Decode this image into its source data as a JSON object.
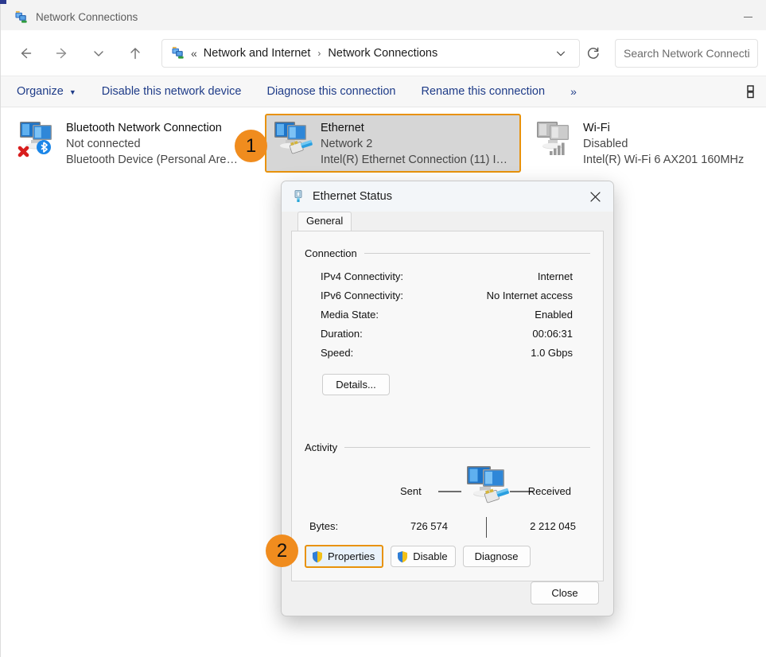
{
  "window": {
    "title": "Network Connections",
    "app_icon": "network-connections-icon",
    "minimize_label": "Minimize"
  },
  "nav": {
    "back": "back-arrow-icon",
    "forward": "forward-arrow-icon",
    "recent": "chevron-down-icon",
    "up": "up-arrow-icon"
  },
  "address": {
    "icon": "network-connections-icon",
    "overflow": "«",
    "crumbs": [
      "Network and Internet",
      "Network Connections"
    ],
    "separator": "›",
    "dropdown": "chevron-down-icon",
    "refresh": "refresh-icon"
  },
  "search": {
    "placeholder": "Search Network Connecti",
    "value": ""
  },
  "commandbar": {
    "items": [
      {
        "label": "Organize",
        "has_caret": true
      },
      {
        "label": "Disable this network device",
        "has_caret": false
      },
      {
        "label": "Diagnose this connection",
        "has_caret": false
      },
      {
        "label": "Rename this connection",
        "has_caret": false
      }
    ],
    "more": "»",
    "view_icon": "view-options-icon"
  },
  "connections": [
    {
      "name": "Bluetooth Network Connection",
      "status": "Not connected",
      "device": "Bluetooth Device (Personal Area …",
      "icon": "bluetooth-network-adapter-icon",
      "selected": false
    },
    {
      "name": "Ethernet",
      "status": "Network 2",
      "device": "Intel(R) Ethernet Connection (11) I…",
      "icon": "ethernet-adapter-icon",
      "selected": true
    },
    {
      "name": "Wi-Fi",
      "status": "Disabled",
      "device": "Intel(R) Wi-Fi 6 AX201 160MHz",
      "icon": "wifi-adapter-disabled-icon",
      "selected": false
    }
  ],
  "badges": [
    {
      "number": "1"
    },
    {
      "number": "2"
    }
  ],
  "dialog": {
    "title": "Ethernet Status",
    "icon": "network-cable-icon",
    "close": "close-icon",
    "tabs": [
      {
        "label": "General",
        "active": true
      }
    ],
    "connection": {
      "group_label": "Connection",
      "rows": [
        {
          "key": "IPv4 Connectivity:",
          "value": "Internet"
        },
        {
          "key": "IPv6 Connectivity:",
          "value": "No Internet access"
        },
        {
          "key": "Media State:",
          "value": "Enabled"
        },
        {
          "key": "Duration:",
          "value": "00:06:31"
        },
        {
          "key": "Speed:",
          "value": "1.0 Gbps"
        }
      ],
      "details_button": "Details..."
    },
    "activity": {
      "group_label": "Activity",
      "sent_label": "Sent",
      "received_label": "Received",
      "icon": "activity-transfer-icon",
      "bytes_label": "Bytes:",
      "bytes_sent": "726 574",
      "bytes_received": "2 212 045"
    },
    "actions": [
      {
        "label": "Properties",
        "shield": true,
        "focused": true
      },
      {
        "label": "Disable",
        "shield": true,
        "focused": false
      },
      {
        "label": "Diagnose",
        "shield": false,
        "focused": false
      }
    ],
    "close_button": "Close"
  },
  "colors": {
    "accent_orange": "#e8920b",
    "badge_orange": "#f08c1e",
    "link_blue": "#1f3c88",
    "selected_tile": "#d6d6d6"
  }
}
